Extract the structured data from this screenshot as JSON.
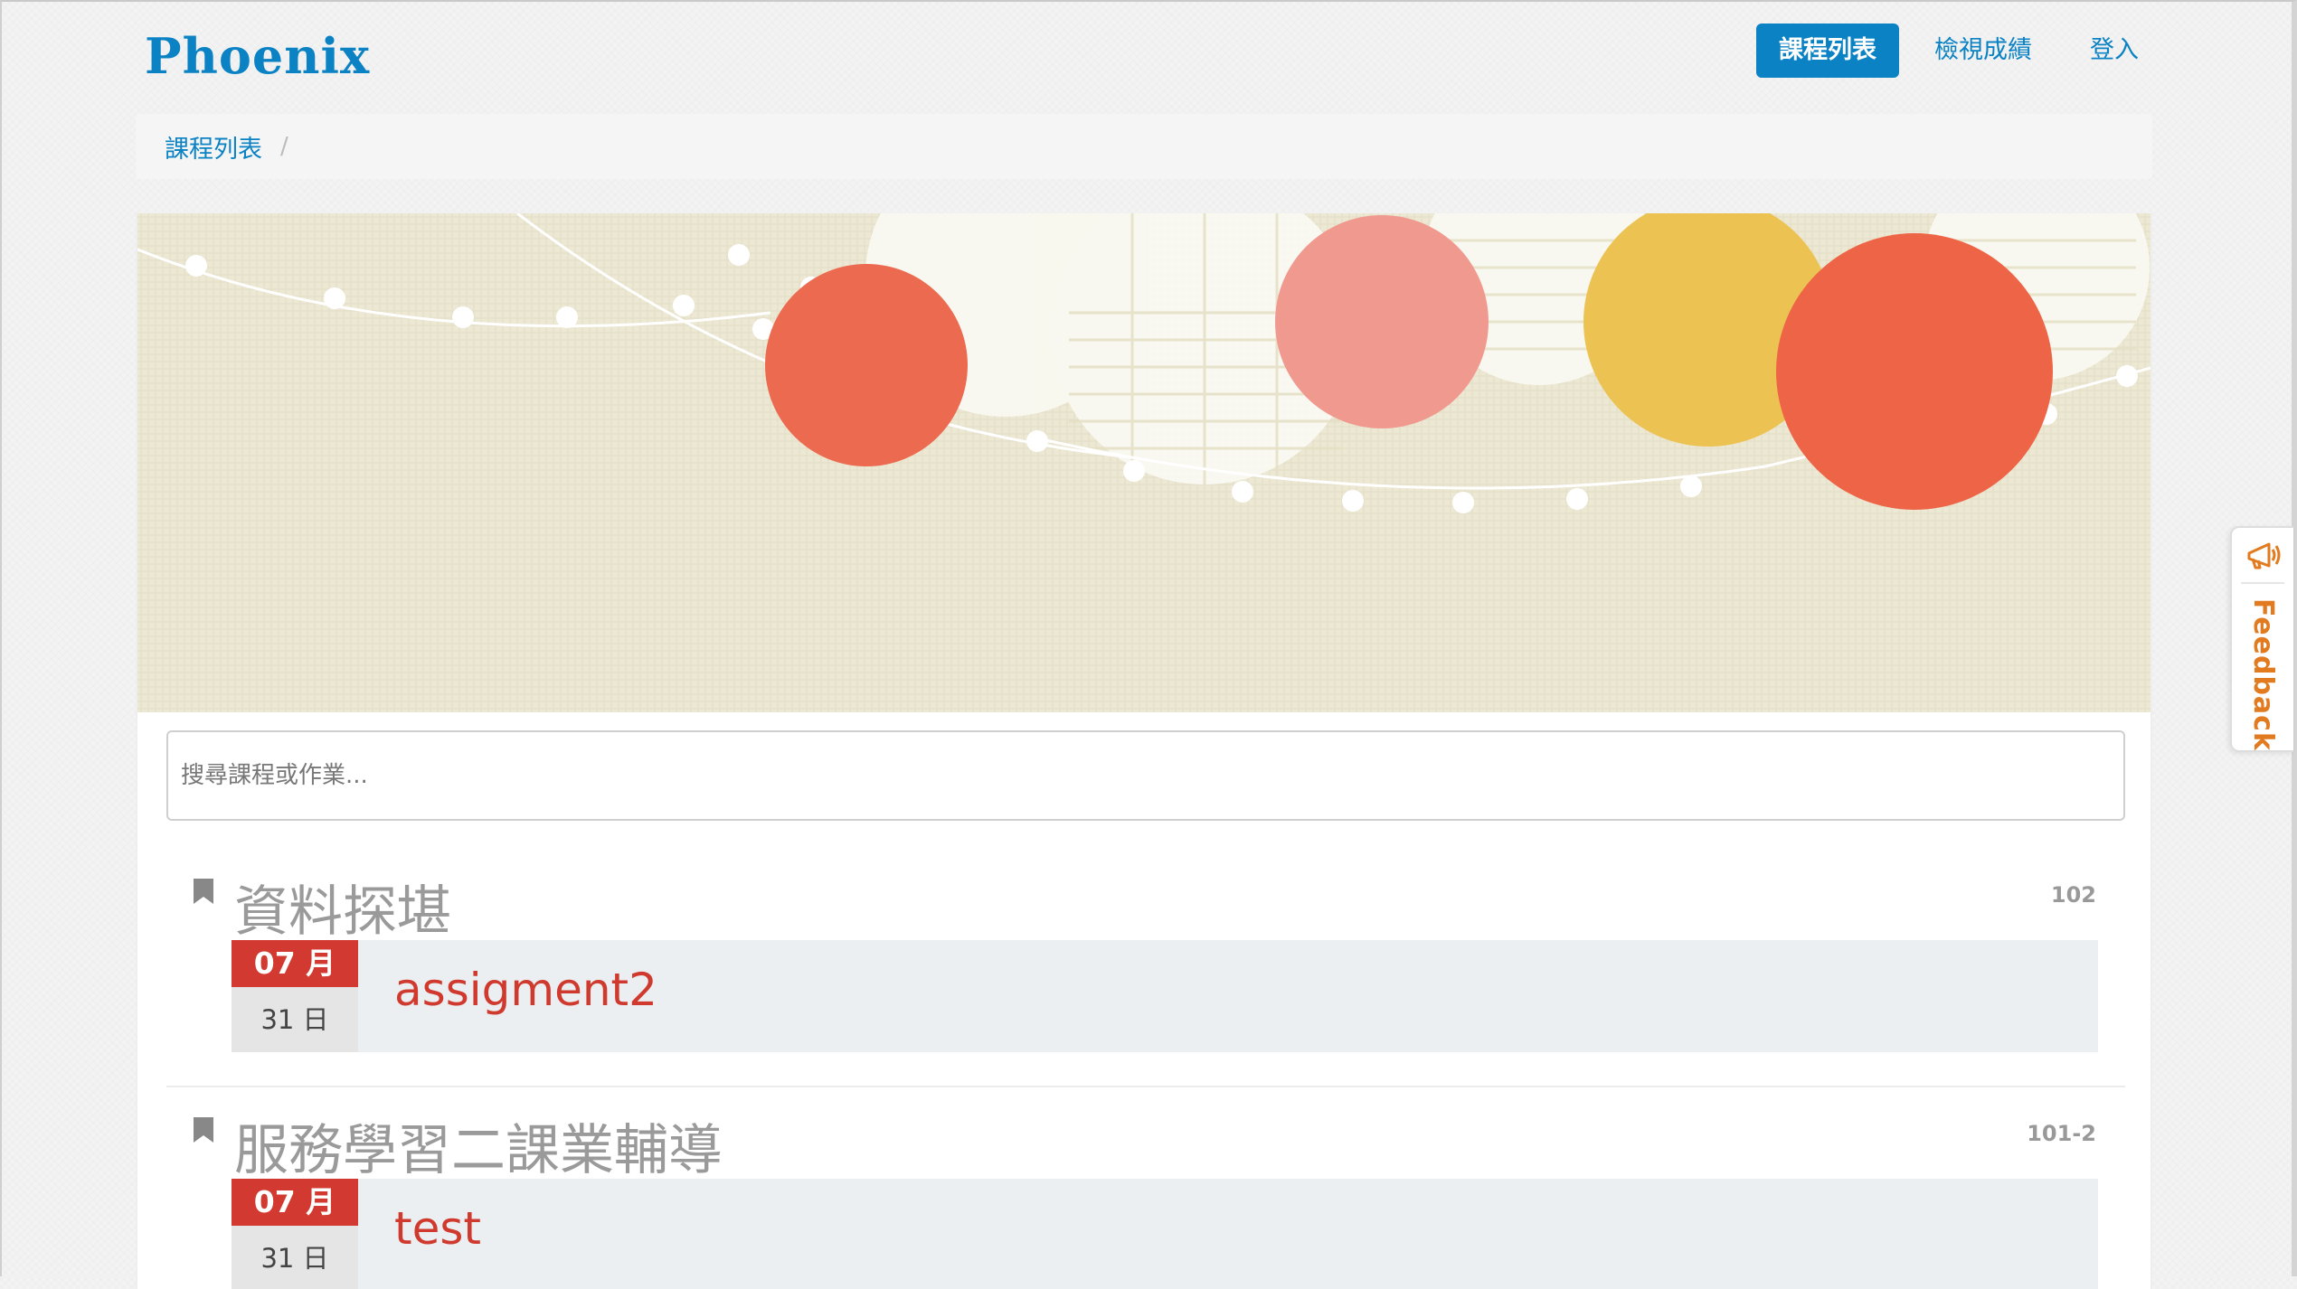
{
  "brand": "Phoenix",
  "nav": {
    "course_list": "課程列表",
    "view_grades": "檢視成績",
    "login": "登入"
  },
  "breadcrumb": {
    "current": "課程列表",
    "separator": "/"
  },
  "search": {
    "placeholder": "搜尋課程或作業..."
  },
  "courses": [
    {
      "title": "資料探堪",
      "term": "102",
      "assignment": {
        "month": "07 月",
        "day": "31 日",
        "name": "assigment2"
      }
    },
    {
      "title": "服務學習二課業輔導",
      "term": "101-2",
      "assignment": {
        "month": "07 月",
        "day": "31 日",
        "name": "test"
      }
    }
  ],
  "feedback": {
    "label": "Feedback",
    "icon": "megaphone-icon"
  },
  "colors": {
    "brand": "#0b82c4",
    "date_red": "#d23a31",
    "feedback_orange": "#e27a1f"
  }
}
